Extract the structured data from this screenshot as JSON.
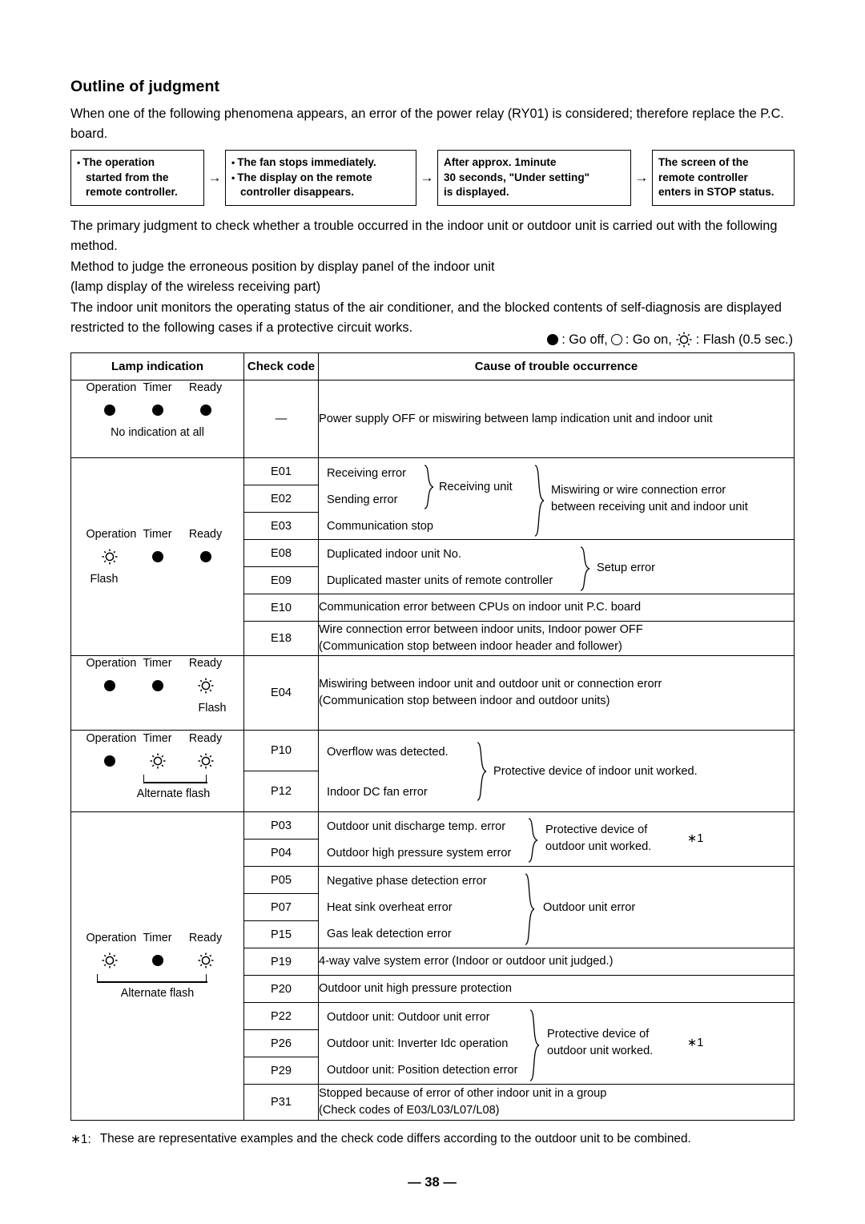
{
  "heading": "Outline of judgment",
  "intro_paragraph": "When one of the following phenomena appears, an error of the power relay (RY01) is considered; therefore replace the P.C. board.",
  "flow": {
    "arrow": "→",
    "bullet": "•",
    "boxes": [
      {
        "lines": [
          "The operation",
          "started from the",
          "remote controller."
        ],
        "bulleted": true
      },
      {
        "lines": [
          "The fan stops immediately.",
          "The display on the remote",
          "controller disappears."
        ],
        "bulleted": true
      },
      {
        "lines": [
          "After approx. 1minute",
          "30 seconds, \"Under setting\"",
          "is displayed."
        ],
        "bulleted": false
      },
      {
        "lines": [
          "The screen of the",
          "remote controller",
          "enters in STOP status."
        ],
        "bulleted": false
      }
    ]
  },
  "paragraphs": {
    "p2": "The primary judgment to check whether a trouble occurred in the indoor unit or outdoor unit is carried out with the following method.",
    "p3_line1": "Method to judge the erroneous position by display panel of the indoor unit",
    "p3_line2": "(lamp display of the wireless receiving part)",
    "p4": "The indoor unit monitors the operating status of the air conditioner, and the blocked contents of self-diagnosis are displayed restricted to the following cases if a protective circuit works."
  },
  "legend": {
    "go_off": ": Go off,",
    "go_on": ": Go on,",
    "flash": ": Flash (0.5 sec.)"
  },
  "table": {
    "headers": {
      "lamp": "Lamp indication",
      "code": "Check code",
      "cause": "Cause of trouble occurrence"
    },
    "lamp_labels": {
      "operation": "Operation",
      "timer": "Timer",
      "ready": "Ready"
    },
    "captions": {
      "no_indication": "No indication at all",
      "flash": "Flash",
      "alternate_flash": "Alternate flash"
    },
    "groups": [
      {
        "id": "group-no-indication",
        "lamps": [
          "off",
          "off",
          "off"
        ],
        "caption": "No indication at all",
        "rows": [
          {
            "code": "—",
            "cause": "Power supply OFF or miswiring between lamp indication unit and indoor unit"
          }
        ]
      },
      {
        "id": "group-operation-flash",
        "lamps": [
          "flash",
          "off",
          "off"
        ],
        "caption": "Flash",
        "rows": [
          {
            "code": "E01",
            "cause": "Receiving error"
          },
          {
            "code": "E02",
            "cause": "Sending error"
          },
          {
            "code": "E03",
            "cause": "Communication stop"
          },
          {
            "code": "E08",
            "cause": "Duplicated indoor unit No."
          },
          {
            "code": "E09",
            "cause": "Duplicated master units of remote controller"
          },
          {
            "code": "E10",
            "cause": "Communication error between CPUs on indoor unit P.C. board"
          },
          {
            "code": "E18",
            "cause": "Wire connection error between indoor units, Indoor power OFF\n(Communication stop between indoor header and follower)"
          }
        ],
        "brace_labels": {
          "receiving_unit": "Receiving unit",
          "miswiring": "Miswiring or wire connection error\nbetween receiving unit and indoor unit",
          "setup_error": "Setup error"
        }
      },
      {
        "id": "group-ready-flash",
        "lamps": [
          "off",
          "off",
          "flash"
        ],
        "caption": "Flash",
        "rows": [
          {
            "code": "E04",
            "cause": "Miswiring between indoor unit and outdoor unit or connection erorr\n(Communication stop between indoor and outdoor units)"
          }
        ]
      },
      {
        "id": "group-timer-ready-alt-flash",
        "lamps": [
          "off",
          "flash",
          "flash"
        ],
        "caption": "Alternate flash",
        "rows": [
          {
            "code": "P10",
            "cause": "Overflow was detected."
          },
          {
            "code": "P12",
            "cause": "Indoor DC fan error"
          }
        ],
        "brace_labels": {
          "indoor_protective": "Protective device of indoor unit worked."
        }
      },
      {
        "id": "group-operation-ready-alt-flash",
        "lamps": [
          "flash",
          "off",
          "flash"
        ],
        "caption": "Alternate flash",
        "rows": [
          {
            "code": "P03",
            "cause": "Outdoor unit discharge temp. error"
          },
          {
            "code": "P04",
            "cause": "Outdoor high pressure system error"
          },
          {
            "code": "P05",
            "cause": "Negative phase detection error"
          },
          {
            "code": "P07",
            "cause": "Heat sink overheat error"
          },
          {
            "code": "P15",
            "cause": "Gas leak detection error"
          },
          {
            "code": "P19",
            "cause": "4-way valve system error (Indoor or outdoor unit judged.)"
          },
          {
            "code": "P20",
            "cause": "Outdoor unit high pressure protection"
          },
          {
            "code": "P22",
            "cause": "Outdoor unit: Outdoor unit error"
          },
          {
            "code": "P26",
            "cause": "Outdoor unit: Inverter Idc operation"
          },
          {
            "code": "P29",
            "cause": "Outdoor unit: Position detection error"
          },
          {
            "code": "P31",
            "cause": "Stopped because of error of other indoor unit in a group\n(Check codes of E03/L03/L07/L08)"
          }
        ],
        "brace_labels": {
          "outdoor_protective_1": "Protective device of\noutdoor unit worked.",
          "outdoor_unit_error": "Outdoor unit error",
          "outdoor_protective_2": "Protective device of\noutdoor unit worked.",
          "asterisk_1": "∗1",
          "asterisk_2": "∗1"
        }
      }
    ]
  },
  "footnote": {
    "marker": "∗1:",
    "text": "These are representative examples and the check code differs according to the outdoor unit to be combined."
  },
  "page_number": "— 38 —"
}
